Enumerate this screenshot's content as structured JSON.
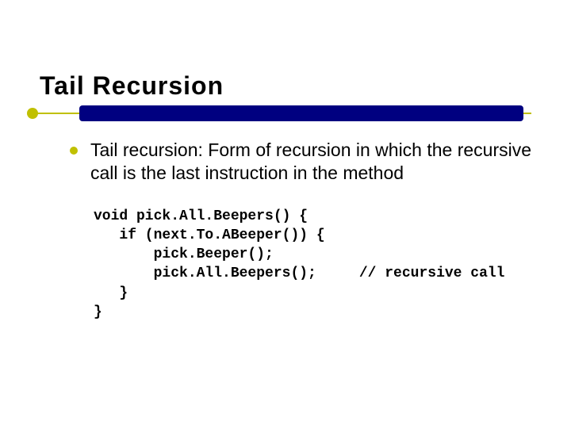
{
  "slide": {
    "title": "Tail Recursion",
    "bullet": "Tail recursion: Form of recursion in which the recursive call is the last instruction in the method",
    "code": "void pick.All.Beepers() {\n   if (next.To.ABeeper()) {\n       pick.Beeper();\n       pick.All.Beepers();     // recursive call\n   }\n}"
  }
}
